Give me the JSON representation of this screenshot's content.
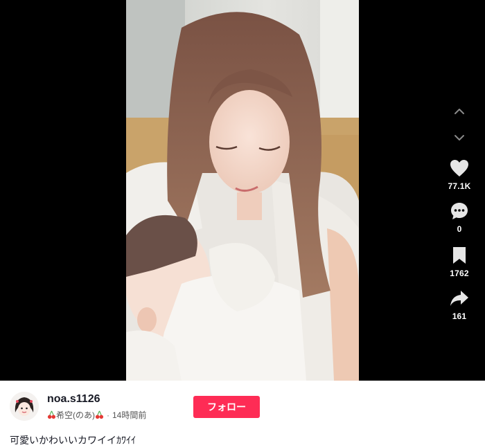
{
  "video": {
    "description": ""
  },
  "actions": {
    "likes": "77.1K",
    "comments": "0",
    "saves": "1762",
    "shares": "161"
  },
  "author": {
    "username": "noa.s1126",
    "display_name": "希空(のあ)",
    "posted_ago": "14時間前"
  },
  "follow_label": "フォロー",
  "caption": "可愛いかわいいカワイイｶﾜｲｲ",
  "colors": {
    "accent": "#fe2c55",
    "player_bg": "#000000"
  },
  "icons": [
    "chevron-up-icon",
    "chevron-down-icon",
    "heart-icon",
    "comment-icon",
    "bookmark-icon",
    "share-icon",
    "cherry-icon"
  ]
}
